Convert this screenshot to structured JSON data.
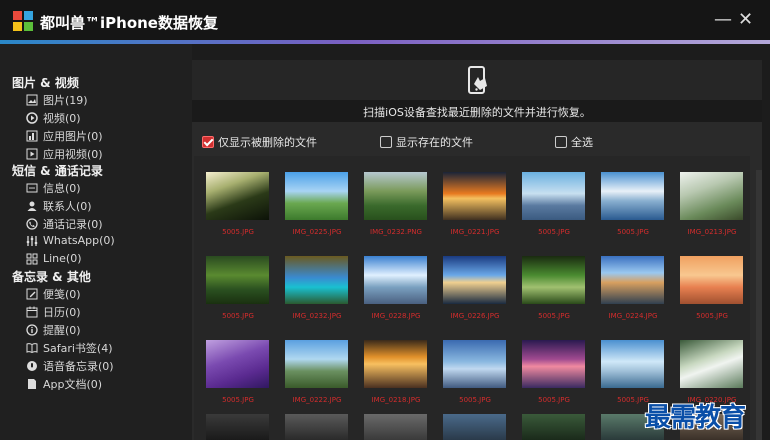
{
  "app": {
    "title": "都叫兽™iPhone数据恢复",
    "minimize": "—",
    "close": "✕"
  },
  "sidebar": {
    "groups": [
      {
        "label": "图片 & 视频",
        "items": [
          "图片(19)",
          "视频(0)",
          "应用图片(0)",
          "应用视频(0)"
        ]
      },
      {
        "label": "短信 & 通话记录",
        "items": [
          "信息(0)",
          "联系人(0)",
          "通话记录(0)",
          "WhatsApp(0)",
          "Line(0)"
        ]
      },
      {
        "label": "备忘录 & 其他",
        "items": [
          "便笺(0)",
          "日历(0)",
          "提醒(0)",
          "Safari书签(4)",
          "语音备忘录(0)",
          "App文档(0)"
        ]
      }
    ]
  },
  "main": {
    "scan_text": "扫描iOS设备查找最近删除的文件并进行恢复。",
    "filters": {
      "deleted_only": "仅显示被删除的文件",
      "existing": "显示存在的文件",
      "select_all": "全选"
    },
    "files": [
      "5005.JPG",
      "IMG_0225.JPG",
      "IMG_0232.PNG",
      "IMG_0221.JPG",
      "5005.JPG",
      "5005.JPG",
      "IMG_0213.JPG",
      "5005.JPG",
      "IMG_0232.JPG",
      "IMG_0228.JPG",
      "IMG_0226.JPG",
      "5005.JPG",
      "IMG_0224.JPG",
      "5005.JPG",
      "5005.JPG",
      "IMG_0222.JPG",
      "IMG_0218.JPG",
      "5005.JPG",
      "5005.JPG",
      "5005.JPG",
      "IMG_0220.JPG"
    ]
  },
  "watermark": "最需教育",
  "colors": {
    "accent_start": "#2a88c8",
    "accent_end": "#b3a7d9",
    "filename": "#d42c2c",
    "checkbox_checked": "#d03030"
  }
}
